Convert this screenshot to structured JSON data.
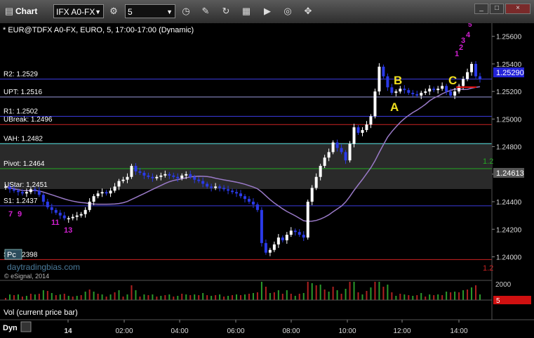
{
  "window": {
    "title": "Chart",
    "symbol_field": "IFX A0-FX",
    "interval_field": "5",
    "minimize": "_",
    "maximize": "□",
    "close": "×"
  },
  "chart_data": {
    "type": "candlestick",
    "title": "* EUR@TDFX A0-FX, EURO, 5, 17:00-17:00 (Dynamic)",
    "ylim": [
      1.2388,
      1.2567
    ],
    "y_ticks": [
      "1.25600",
      "1.25400",
      "1.25200",
      "1.25000",
      "1.24800",
      "1.24600",
      "1.24400",
      "1.24200",
      "1.24000"
    ],
    "x_ticks": [
      "14",
      "02:00",
      "04:00",
      "06:00",
      "08:00",
      "10:00",
      "12:00",
      "14:00"
    ],
    "levels": [
      {
        "label": "R2: 1.2529",
        "value": 1.2529,
        "color": "#3a3adc"
      },
      {
        "label": "UPT: 1.2516",
        "value": 1.2516,
        "color": "#9a9adc"
      },
      {
        "label": "R1: 1.2502",
        "value": 1.2502,
        "color": "#3a3adc"
      },
      {
        "label": "UBreak: 1.2496",
        "value": 1.2496,
        "color": "#cc2222"
      },
      {
        "label": "VAH: 1.2482",
        "value": 1.2482,
        "color": "#40c8c8"
      },
      {
        "label": "Pivot: 1.2464",
        "value": 1.2464,
        "color": "#22aa22"
      },
      {
        "label": "S1: 1.2437",
        "value": 1.2437,
        "color": "#3a3adc"
      },
      {
        "label": "S2: 1.2398",
        "value": 1.2398,
        "color": "#cc2222"
      }
    ],
    "last_price": "1.25290",
    "ma_last": "1.24613",
    "annotations": [
      "A",
      "B",
      "C"
    ],
    "td_counts": [
      "7",
      "9",
      "11",
      "13",
      "1",
      "2",
      "3",
      "4",
      "5"
    ],
    "partial_labels": [
      "UStar: 1.2451",
      "1.2",
      "1.2"
    ],
    "series": [
      {
        "name": "EUR@TDFX A0-FX",
        "values": [
          1.2451,
          1.2449,
          1.2448,
          1.2447,
          1.2446,
          1.2447,
          1.2449,
          1.2448,
          1.2445,
          1.244,
          1.2436,
          1.2434,
          1.2432,
          1.243,
          1.2428,
          1.2428,
          1.2429,
          1.243,
          1.2431,
          1.2434,
          1.244,
          1.2444,
          1.2446,
          1.2447,
          1.2446,
          1.2448,
          1.2451,
          1.2455,
          1.2456,
          1.2458,
          1.2466,
          1.2462,
          1.2461,
          1.2459,
          1.2458,
          1.2457,
          1.2458,
          1.2459,
          1.246,
          1.2459,
          1.2458,
          1.2457,
          1.2459,
          1.246,
          1.2458,
          1.2456,
          1.2455,
          1.2453,
          1.2451,
          1.245,
          1.2451,
          1.245,
          1.2449,
          1.2448,
          1.2447,
          1.2446,
          1.2444,
          1.2442,
          1.244,
          1.2438,
          1.2434,
          1.241,
          1.2403,
          1.2405,
          1.2409,
          1.2414,
          1.2412,
          1.2416,
          1.2419,
          1.2418,
          1.2416,
          1.2414,
          1.244,
          1.245,
          1.2458,
          1.2466,
          1.2472,
          1.2476,
          1.2483,
          1.2479,
          1.2476,
          1.247,
          1.2482,
          1.2494,
          1.249,
          1.2492,
          1.2496,
          1.2502,
          1.252,
          1.2538,
          1.2531,
          1.2523,
          1.2519,
          1.252,
          1.2522,
          1.2521,
          1.2519,
          1.2518,
          1.2517,
          1.2519,
          1.252,
          1.2522,
          1.2521,
          1.2522,
          1.2524,
          1.252,
          1.2517,
          1.252,
          1.2524,
          1.2529,
          1.2534,
          1.254,
          1.2531,
          1.2529
        ]
      }
    ],
    "volume": {
      "ylabel": "Vol (current price bar)",
      "tick": "2000",
      "last": "5"
    },
    "watermark": "daytradingbias.com",
    "copyright": "© eSignal, 2014",
    "study_tag": "Pc",
    "footer_tag": "Dyn"
  }
}
